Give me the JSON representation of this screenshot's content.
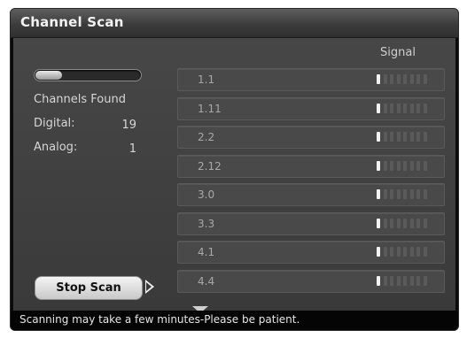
{
  "title": "Channel Scan",
  "signal_header": "Signal",
  "progress": 0.25,
  "channels_found_label": "Channels Found",
  "digital": {
    "label": "Digital:",
    "value": "19"
  },
  "analog": {
    "label": "Analog:",
    "value": "1"
  },
  "channels": [
    {
      "label": "1.1",
      "signal_bars": 1
    },
    {
      "label": "1.11",
      "signal_bars": 1
    },
    {
      "label": "2.2",
      "signal_bars": 1
    },
    {
      "label": "2.12",
      "signal_bars": 1
    },
    {
      "label": "3.0",
      "signal_bars": 1
    },
    {
      "label": "3.3",
      "signal_bars": 1
    },
    {
      "label": "4.1",
      "signal_bars": 1
    },
    {
      "label": "4.4",
      "signal_bars": 1
    }
  ],
  "signal_bar_total": 8,
  "stop_button_label": "Stop Scan",
  "status_message": "Scanning may take a few minutes-Please be patient.",
  "colors": {
    "signal_on": "#f2f2f2",
    "signal_off": "#5a5a5a",
    "panel": "#3f3f3f"
  }
}
